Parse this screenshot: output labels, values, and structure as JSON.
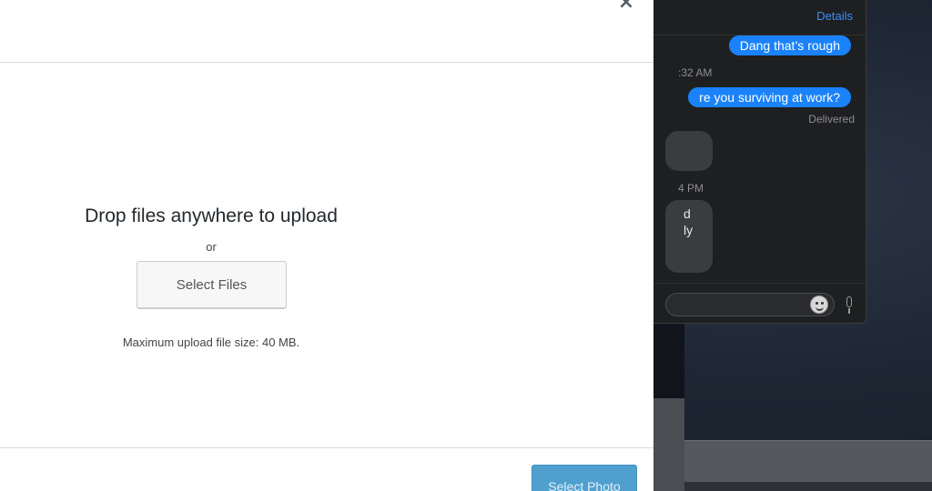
{
  "modal": {
    "close_glyph": "×",
    "drop_title": "Drop files anywhere to upload",
    "or_text": "or",
    "select_files_label": "Select Files",
    "max_upload_text": "Maximum upload file size: 40 MB.",
    "select_photo_label": "Select Photo"
  },
  "messages": {
    "details_label": "Details",
    "outgoing": [
      "Dang that’s rough",
      "re you surviving at work?"
    ],
    "timestamps": [
      ":32 AM",
      "4 PM"
    ],
    "delivered_label": "Delivered",
    "incoming_partial_text": [
      "d",
      "ly"
    ]
  },
  "colors": {
    "accent_blue": "#1a82fb",
    "primary_button": "#4fa0cf",
    "messages_bg": "#1e1f21"
  }
}
